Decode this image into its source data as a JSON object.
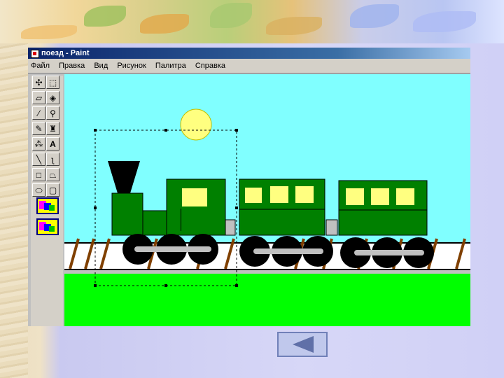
{
  "window": {
    "title": "поезд - Paint"
  },
  "menu": {
    "items": [
      "Файл",
      "Правка",
      "Вид",
      "Рисунок",
      "Палитра",
      "Справка"
    ]
  },
  "tools": {
    "icons": [
      "free-select-icon",
      "rect-select-icon",
      "eraser-icon",
      "fill-icon",
      "picker-icon",
      "magnifier-icon",
      "pencil-icon",
      "brush-icon",
      "airbrush-icon",
      "text-icon",
      "line-icon",
      "curve-icon",
      "rectangle-icon",
      "polygon-icon",
      "ellipse-icon",
      "rounded-rect-icon"
    ],
    "text_glyph": "A"
  },
  "colors": {
    "sky": "#80ffff",
    "grass": "#00ff00",
    "train": "#008000",
    "window": "#ffff80",
    "sun": "#ffff80",
    "wheel": "#000000",
    "axle": "#c0c0c0",
    "rail": "#ffffff",
    "sleeper": "#804000"
  },
  "nav": {
    "back_icon": "left-triangle-icon"
  }
}
